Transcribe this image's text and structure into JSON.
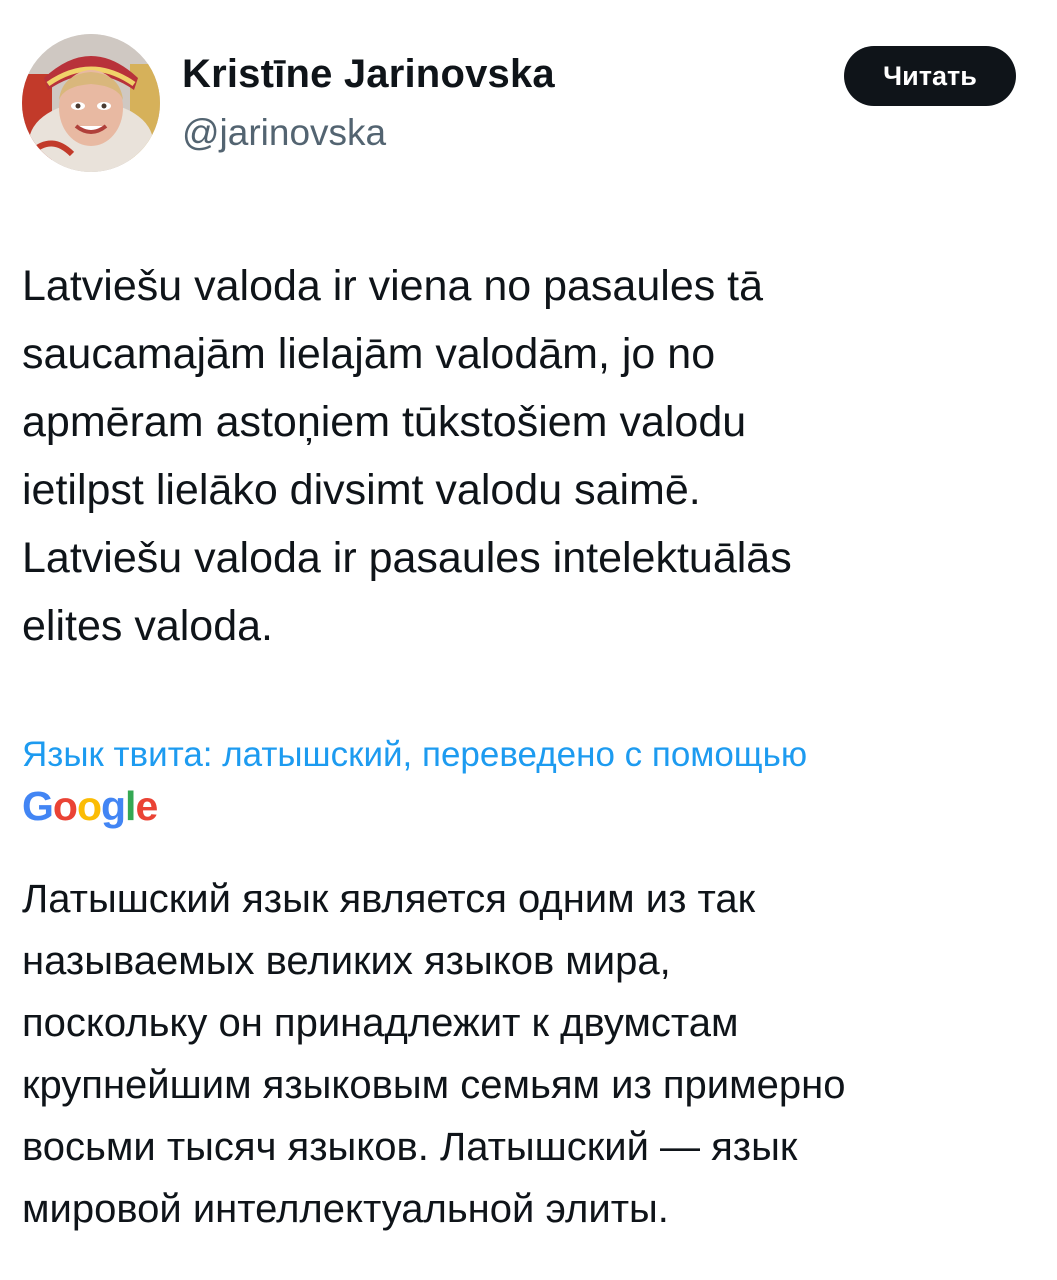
{
  "author": {
    "name": "Kristīne Jarinovska",
    "handle": "@jarinovska"
  },
  "follow_button": {
    "label": "Читать"
  },
  "tweet": {
    "lines": [
      "Latviešu valoda ir viena no pasaules tā",
      "saucamajām lielajām valodām, jo no",
      "apmēram astoņiem tūkstošiem valodu",
      "ietilpst lielāko divsimt valodu saimē.",
      "Latviešu valoda ir pasaules intelektuālās",
      "elites valoda."
    ]
  },
  "translation": {
    "note": "Язык твита: латышский, переведено с помощью",
    "provider_logo": {
      "letters": [
        "G",
        "o",
        "o",
        "g",
        "l",
        "e"
      ],
      "colors": [
        "#4285F4",
        "#EA4335",
        "#FBBC05",
        "#4285F4",
        "#34A853",
        "#EA4335"
      ]
    },
    "lines": [
      "Латышский язык является одним из так",
      "называемых великих языков мира,",
      "поскольку он принадлежит к двумстам",
      "крупнейшим языковым семьям из примерно",
      "восьми тысяч языков. Латышский — язык",
      "мировой интеллектуальной элиты."
    ]
  },
  "colors": {
    "text": "#0f1419",
    "secondary": "#536471",
    "link": "#1d9bf0",
    "button_bg": "#0f1419"
  }
}
